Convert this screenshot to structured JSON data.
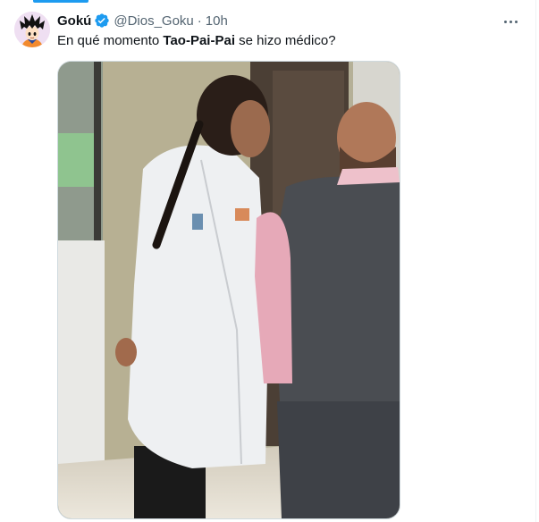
{
  "tweet": {
    "author": {
      "name": "Gokú",
      "handle": "@Dios_Goku",
      "verified": true,
      "avatar_icon": "goku-avatar"
    },
    "separator": "·",
    "time": "10h",
    "text": {
      "before": "En qué momento ",
      "bold": "Tao-Pai-Pai",
      "after": " se hizo médico?"
    },
    "more_icon": "more-options-icon",
    "media": {
      "description": "photo"
    }
  },
  "colors": {
    "accent": "#1d9bf0",
    "text_primary": "#0f1419",
    "text_secondary": "#536471",
    "border": "#cfd9de"
  }
}
